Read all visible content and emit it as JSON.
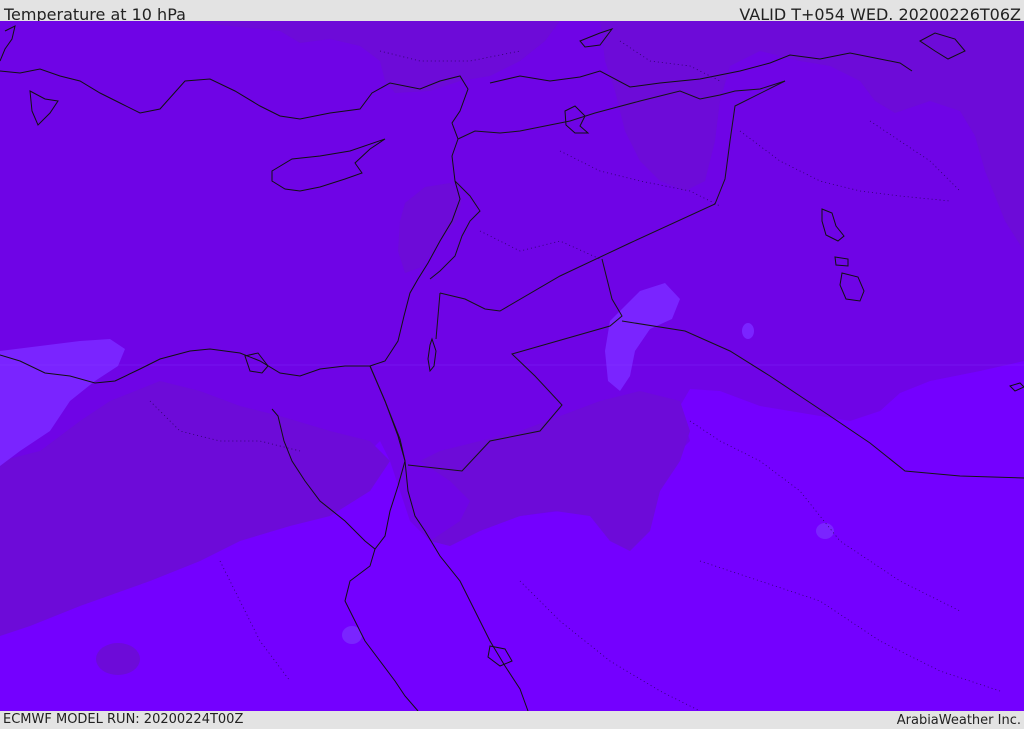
{
  "header": {
    "title": "Temperature at 10 hPa",
    "valid_time": "VALID T+054 WED. 20200226T06Z"
  },
  "footer": {
    "model_run": "ECMWF MODEL RUN: 20200224T00Z",
    "credit": "ArabiaWeather Inc."
  },
  "map": {
    "colors": {
      "background": "#7400ff",
      "warm_band": "#6d0bd8",
      "mid_band": "#6f04e6",
      "light_patch": "#7a24ff",
      "coastline": "#111111",
      "border": "#151515"
    }
  }
}
